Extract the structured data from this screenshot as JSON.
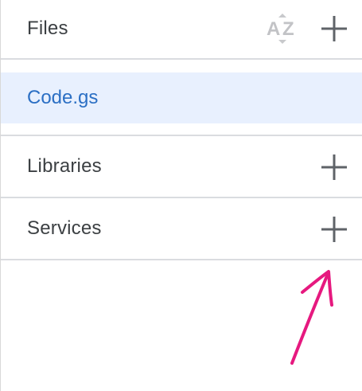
{
  "files": {
    "title": "Files",
    "sort_icon": "sort-az-icon",
    "add_icon": "plus-icon",
    "items": [
      {
        "name": "Code.gs",
        "selected": true
      }
    ]
  },
  "libraries": {
    "title": "Libraries",
    "add_icon": "plus-icon"
  },
  "services": {
    "title": "Services",
    "add_icon": "plus-icon"
  },
  "colors": {
    "selected_bg": "#e8f0fe",
    "selected_text": "#2b6fc4",
    "text": "#3c4043",
    "divider": "#dadce0",
    "icon": "#5f6368",
    "annotation_arrow": "#e6197f"
  }
}
